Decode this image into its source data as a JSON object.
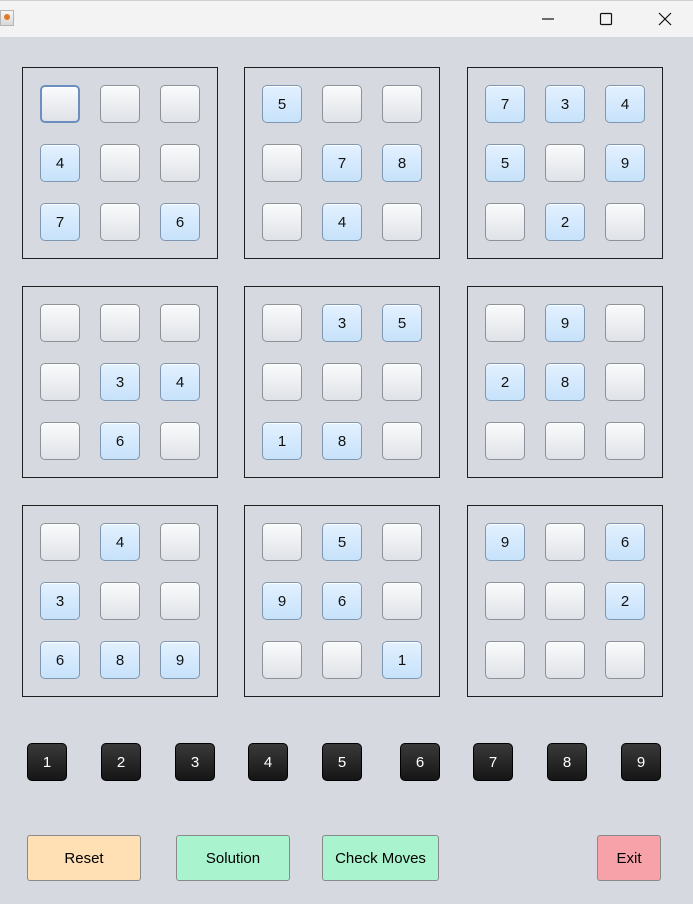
{
  "window": {
    "app_icon": "java-cup-icon",
    "minimize_icon": "minimize-icon",
    "maximize_icon": "maximize-icon",
    "close_icon": "close-icon"
  },
  "board": {
    "blocks": [
      [
        "",
        "",
        "",
        "4",
        "",
        "",
        "7",
        "",
        "6"
      ],
      [
        "5",
        "",
        "",
        "",
        "7",
        "8",
        "",
        "4",
        ""
      ],
      [
        "7",
        "3",
        "4",
        "5",
        "",
        "9",
        "",
        "2",
        ""
      ],
      [
        "",
        "",
        "",
        "",
        "3",
        "4",
        "",
        "6",
        ""
      ],
      [
        "",
        "3",
        "5",
        "",
        "",
        "",
        "1",
        "8",
        ""
      ],
      [
        "",
        "9",
        "",
        "2",
        "8",
        "",
        "",
        "",
        ""
      ],
      [
        "",
        "4",
        "",
        "3",
        "",
        "",
        "6",
        "8",
        "9"
      ],
      [
        "",
        "5",
        "",
        "9",
        "6",
        "",
        "",
        "",
        "1"
      ],
      [
        "9",
        "",
        "6",
        "",
        "",
        "2",
        "",
        "",
        ""
      ]
    ],
    "selected_block": 0,
    "selected_cell": 0
  },
  "number_pad": [
    "1",
    "2",
    "3",
    "4",
    "5",
    "6",
    "7",
    "8",
    "9"
  ],
  "actions": {
    "reset_label": "Reset",
    "solution_label": "Solution",
    "check_label": "Check Moves",
    "exit_label": "Exit"
  },
  "colors": {
    "reset": "#ffdfb4",
    "solution": "#a9f4cf",
    "check": "#a9f4cf",
    "exit": "#f7a1a8",
    "given_cell": "#cfe6fb",
    "background": "#d6d9e0"
  }
}
